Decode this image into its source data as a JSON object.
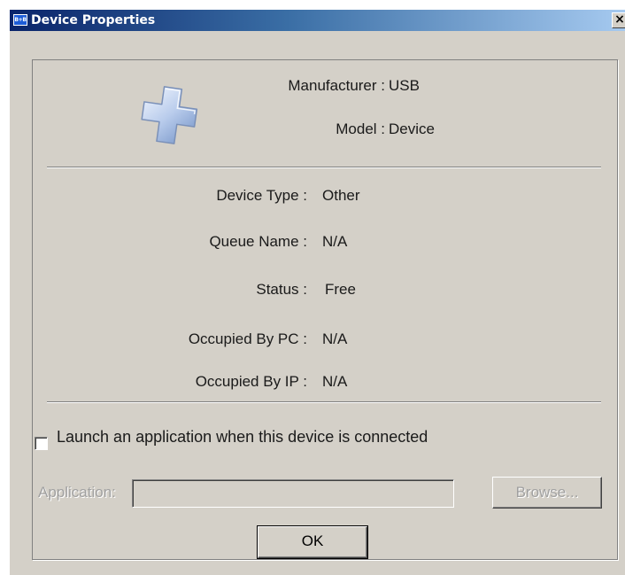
{
  "window": {
    "title": "Device Properties",
    "icon_label": "B+B",
    "close_label": "×"
  },
  "device": {
    "icon": "usb-plus-icon",
    "manufacturer_label": "Manufacturer :",
    "manufacturer_value": "USB",
    "model_label": "Model :",
    "model_value": "Device"
  },
  "properties": {
    "device_type_label": "Device Type :",
    "device_type_value": "Other",
    "queue_name_label": "Queue Name :",
    "queue_name_value": "N/A",
    "status_label": "Status :",
    "status_value": "Free",
    "occupied_pc_label": "Occupied By PC :",
    "occupied_pc_value": "N/A",
    "occupied_ip_label": "Occupied By IP :",
    "occupied_ip_value": "N/A"
  },
  "launch": {
    "checkbox_label": "Launch an application when this device is connected",
    "checked": false,
    "application_label": "Application:",
    "application_value": "",
    "browse_label": "Browse..."
  },
  "actions": {
    "ok_label": "OK"
  }
}
